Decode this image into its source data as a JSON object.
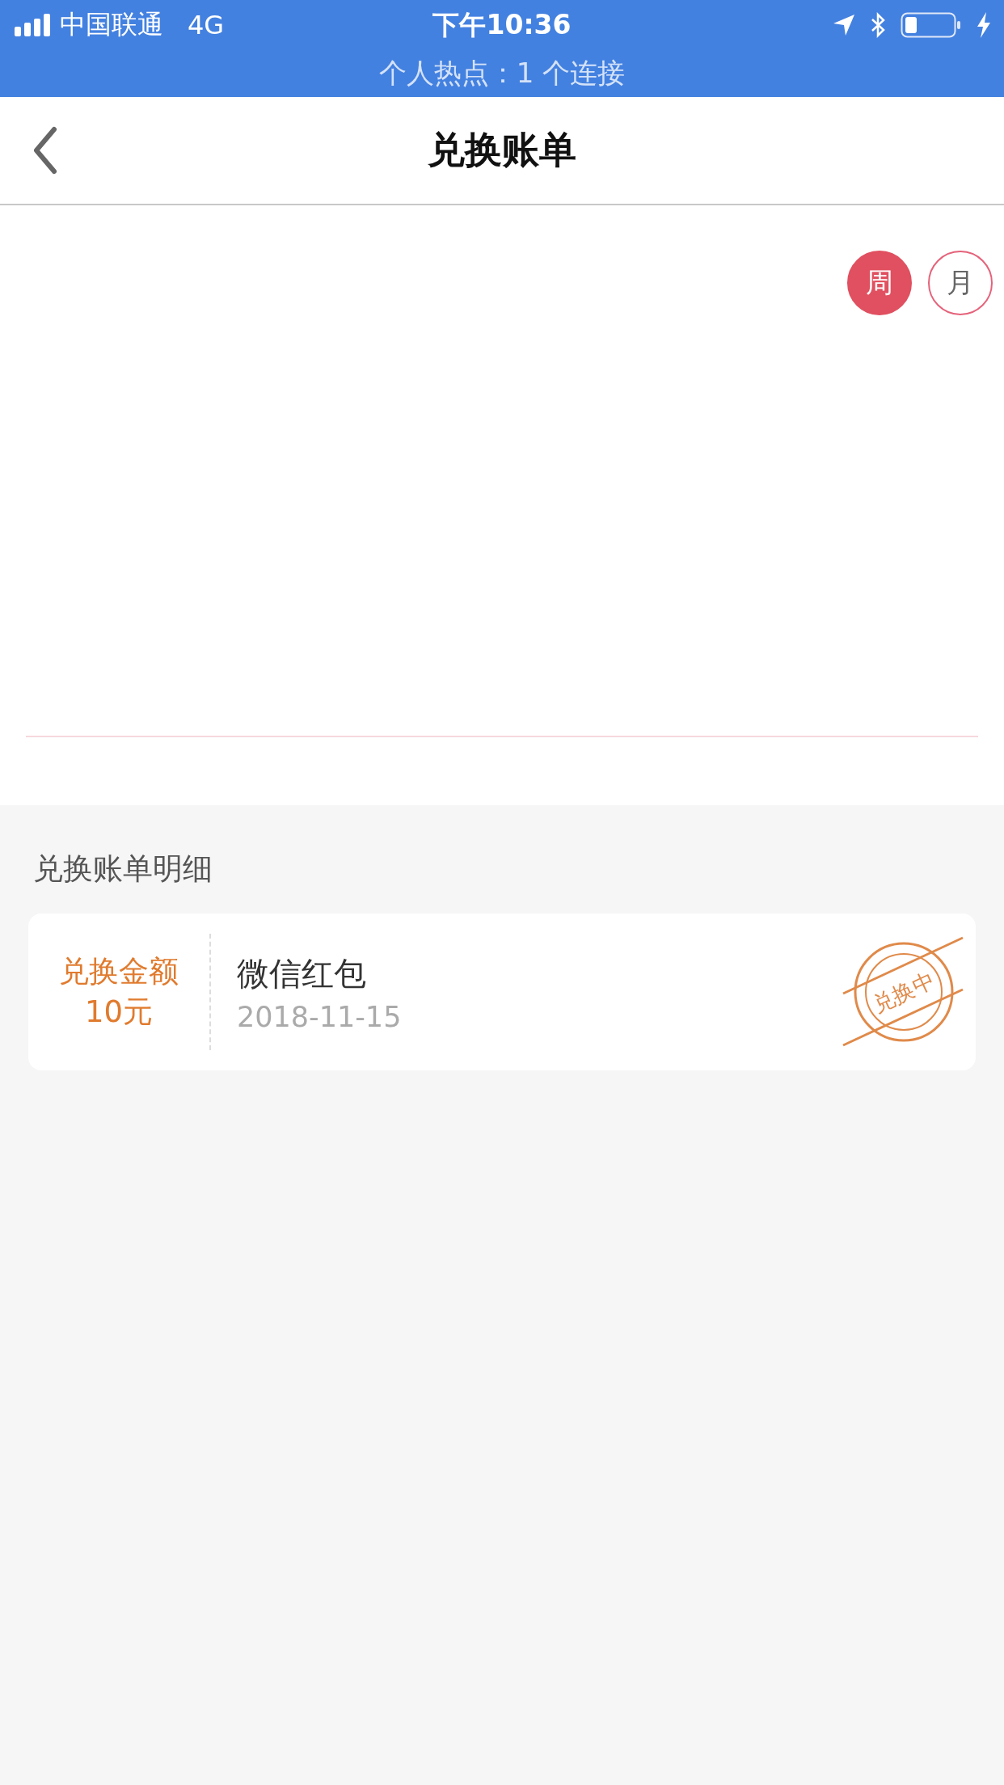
{
  "status_bar": {
    "carrier": "中国联通",
    "network": "4G",
    "time": "下午10:36",
    "hotspot": "个人热点：1 个连接"
  },
  "nav": {
    "title": "兑换账单"
  },
  "period_toggle": [
    {
      "label": "周",
      "selected": true
    },
    {
      "label": "月",
      "selected": false
    }
  ],
  "section_title": "兑换账单明细",
  "records": [
    {
      "amount_label": "兑换金额",
      "amount": "10元",
      "name": "微信红包",
      "date": "2018-11-15",
      "status": "兑换中"
    }
  ]
}
